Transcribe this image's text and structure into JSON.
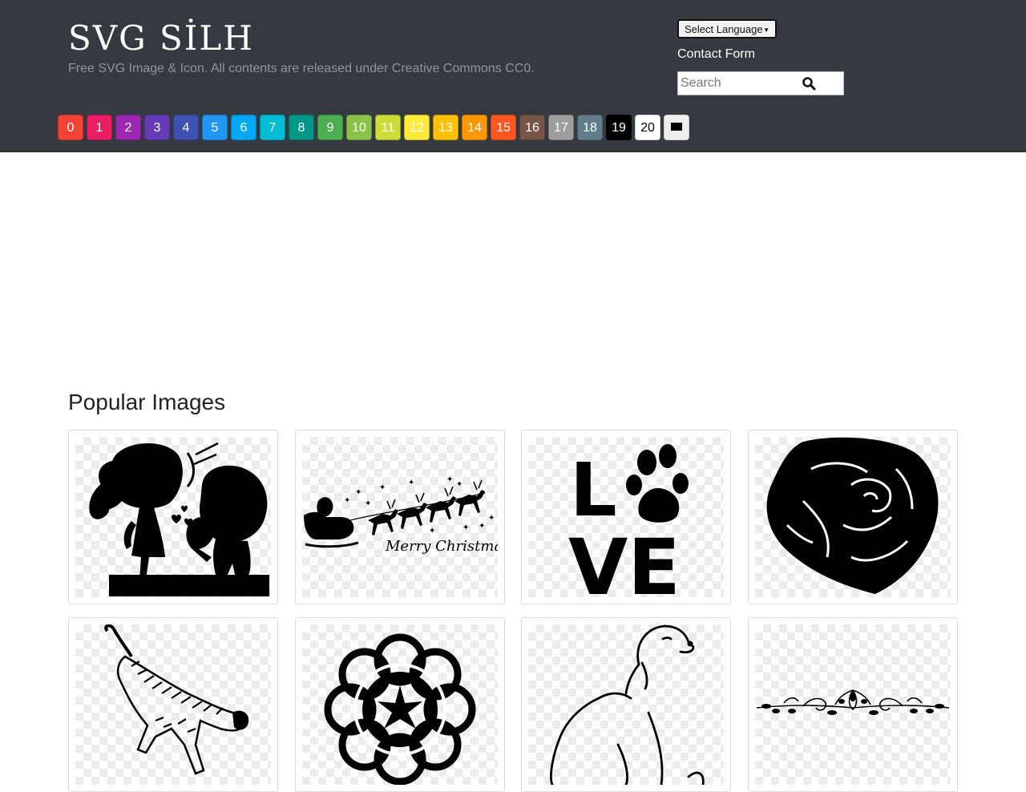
{
  "site": {
    "logo": "SVG SİLH",
    "tagline": "Free SVG Image & Icon. All contents are released under Creative Commons CC0."
  },
  "nav": {
    "language_select": "Select Language",
    "contact": "Contact Form",
    "search_placeholder": "Search"
  },
  "color_filters": [
    {
      "label": "0",
      "color": "#f44336"
    },
    {
      "label": "1",
      "color": "#e91e63"
    },
    {
      "label": "2",
      "color": "#9c27b0"
    },
    {
      "label": "3",
      "color": "#673ab7"
    },
    {
      "label": "4",
      "color": "#3f51b5"
    },
    {
      "label": "5",
      "color": "#2196f3"
    },
    {
      "label": "6",
      "color": "#03a9f4"
    },
    {
      "label": "7",
      "color": "#00bcd4"
    },
    {
      "label": "8",
      "color": "#009688"
    },
    {
      "label": "9",
      "color": "#4caf50"
    },
    {
      "label": "10",
      "color": "#8bc34a"
    },
    {
      "label": "11",
      "color": "#cddc39"
    },
    {
      "label": "12",
      "color": "#ffeb3b"
    },
    {
      "label": "13",
      "color": "#ffc107"
    },
    {
      "label": "14",
      "color": "#ff9800"
    },
    {
      "label": "15",
      "color": "#ff5722"
    },
    {
      "label": "16",
      "color": "#795548"
    },
    {
      "label": "17",
      "color": "#9e9e9e"
    },
    {
      "label": "18",
      "color": "#607d8b"
    },
    {
      "label": "19",
      "color": "#000000"
    },
    {
      "label": "20",
      "color": "#ffffff"
    },
    {
      "label": "",
      "color": "#eeeeee"
    }
  ],
  "popular": {
    "title": "Popular Images",
    "images": [
      {
        "icon": "girl-boy-flowers-silhouette-icon"
      },
      {
        "icon": "santa-sleigh-reindeer-icon",
        "caption": "Merry Christmas"
      },
      {
        "icon": "love-paw-icon",
        "text_top": "L",
        "text_bottom": "VE"
      },
      {
        "icon": "rose-silhouette-icon"
      },
      {
        "icon": "leaping-tiger-icon"
      },
      {
        "icon": "celtic-mandala-icon"
      },
      {
        "icon": "dog-line-art-icon"
      },
      {
        "icon": "floral-border-divider-icon"
      }
    ]
  }
}
